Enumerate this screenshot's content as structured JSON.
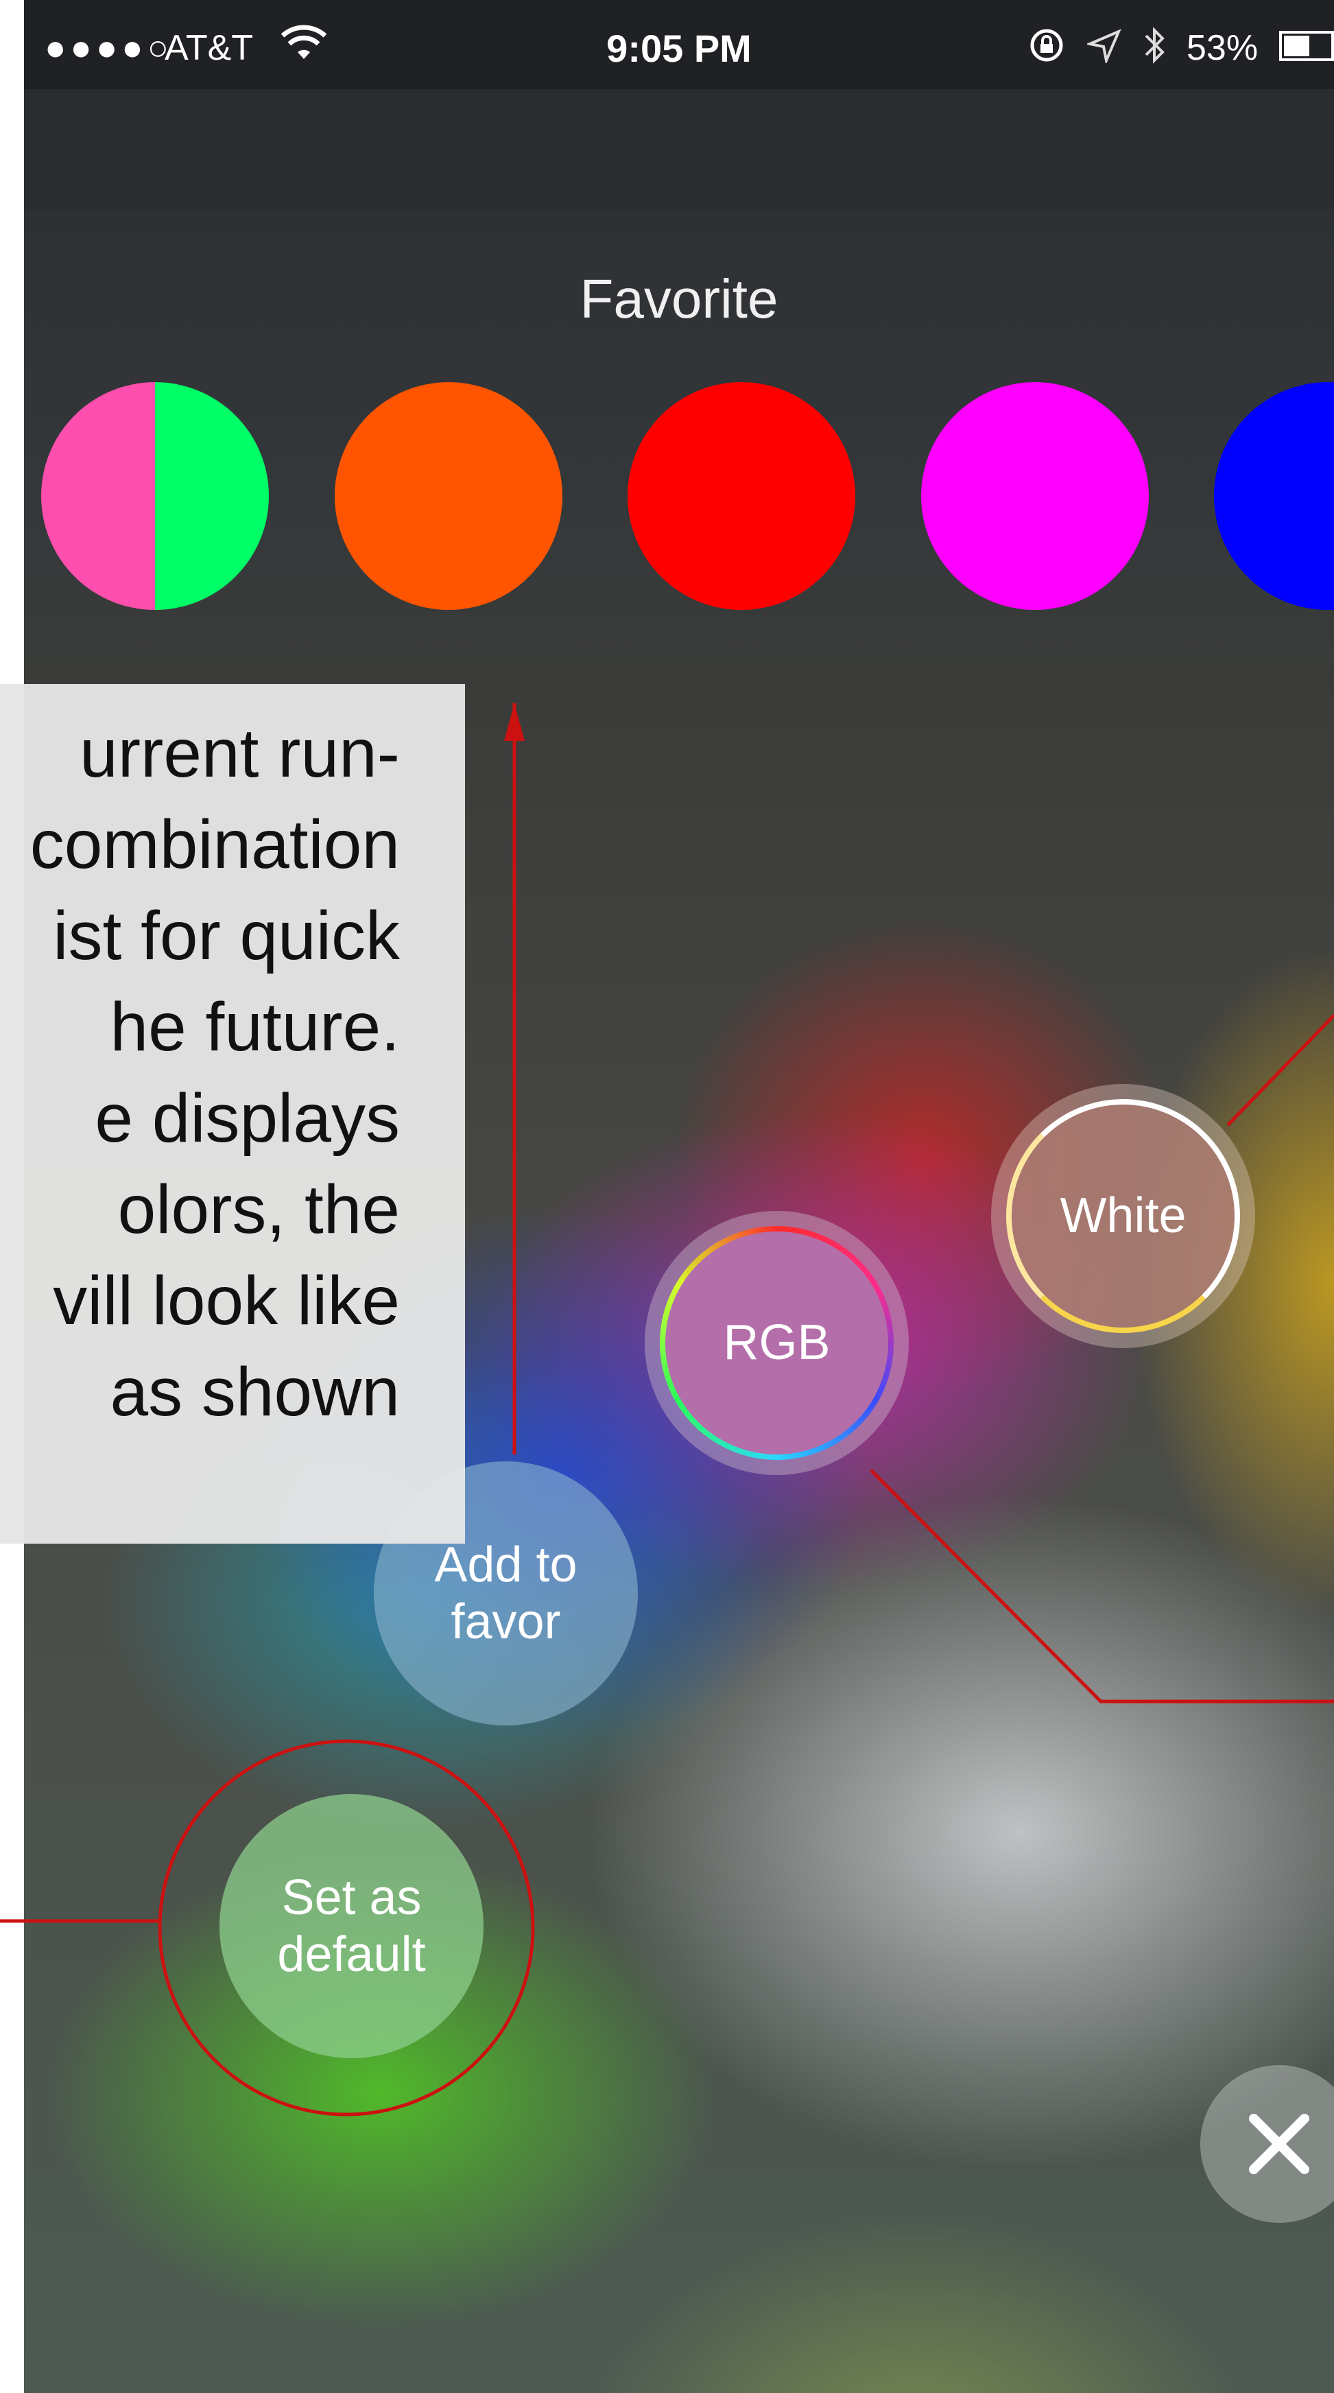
{
  "status_bar": {
    "signal": "●●●●○",
    "carrier": "AT&T",
    "time": "9:05 PM",
    "battery": "53%",
    "battery_level": 0.53
  },
  "favorite": {
    "title": "Favorite",
    "swatches": [
      {
        "name": "pink-green",
        "colors": [
          "#ff4fae",
          "#00ff66"
        ]
      },
      {
        "name": "orange",
        "colors": [
          "#ff5500"
        ]
      },
      {
        "name": "red",
        "colors": [
          "#ff0000"
        ]
      },
      {
        "name": "magenta",
        "colors": [
          "#ff00ff"
        ]
      },
      {
        "name": "blue",
        "colors": [
          "#0000ff"
        ]
      }
    ]
  },
  "annotation": {
    "lines": [
      "urrent run-",
      "combination",
      "ist for quick",
      "he future.",
      "e displays",
      "olors, the",
      "vill look like",
      "as shown"
    ]
  },
  "controls": {
    "set_default": "Set as\ndefault",
    "add_favor": "Add to\nfavor",
    "rgb": "RGB",
    "white": "White",
    "close_icon": "close-icon"
  },
  "colors": {
    "annotation_line": "#cc1111",
    "annotation_box": "#e6e6e6"
  }
}
